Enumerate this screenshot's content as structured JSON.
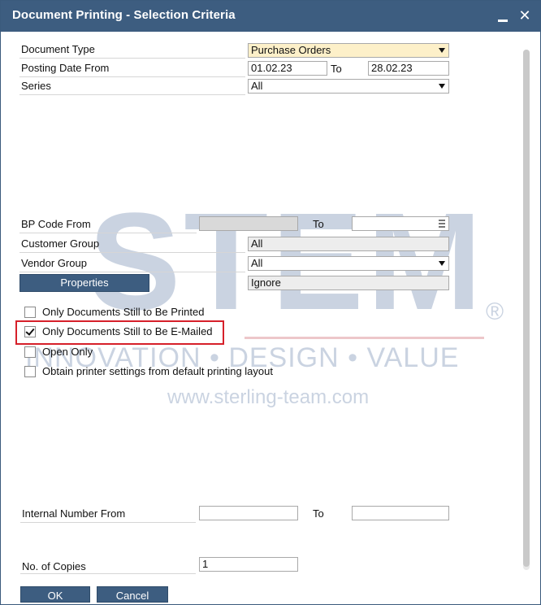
{
  "window": {
    "title": "Document Printing - Selection Criteria",
    "minimize_symbol": "_",
    "close_symbol": "✕"
  },
  "criteria": {
    "document_type": {
      "label": "Document Type",
      "value": "Purchase Orders"
    },
    "posting_date": {
      "label": "Posting Date From",
      "from": "01.02.23",
      "to_label": "To",
      "to": "28.02.23"
    },
    "series": {
      "label": "Series",
      "value": "All"
    },
    "bp_code": {
      "label": "BP Code From",
      "from": "",
      "to_label": "To",
      "to": ""
    },
    "customer_group": {
      "label": "Customer Group",
      "value": "All"
    },
    "vendor_group": {
      "label": "Vendor Group",
      "value": "All"
    },
    "properties": {
      "button_label": "Properties",
      "value": "Ignore"
    }
  },
  "options": [
    {
      "label": "Only Documents Still to Be Printed",
      "checked": false
    },
    {
      "label": "Only Documents Still to Be E-Mailed",
      "checked": true
    },
    {
      "label": "Open Only",
      "checked": false
    },
    {
      "label": "Obtain printer settings from default printing layout",
      "checked": false
    }
  ],
  "internal_number": {
    "label": "Internal Number From",
    "from": "",
    "to_label": "To",
    "to": ""
  },
  "copies": {
    "label": "No. of Copies",
    "value": "1"
  },
  "buttons": {
    "ok": "OK",
    "cancel": "Cancel"
  },
  "watermark": {
    "brand": "STEM",
    "registered": "®",
    "tagline": "INNOVATION • DESIGN • VALUE",
    "url": "www.sterling-team.com"
  },
  "colors": {
    "titlebar": "#3d5d80",
    "highlight": "#d6202a",
    "required_field": "#fdf0c9"
  }
}
